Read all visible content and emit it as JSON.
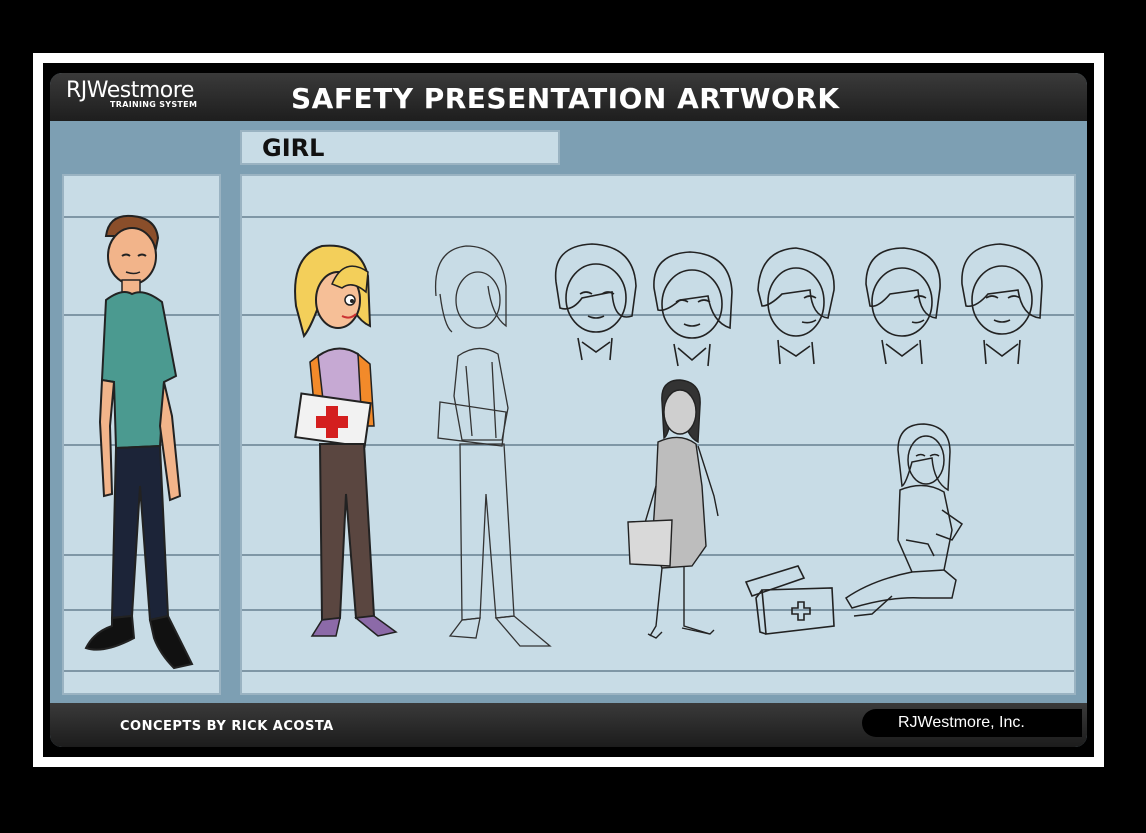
{
  "header": {
    "logo_main": "RJWestmore",
    "logo_sub": "TRAINING SYSTEM",
    "title": "SAFETY PRESENTATION ARTWORK"
  },
  "section_label": "GIRL",
  "footer": {
    "credit": "CONCEPTS BY RICK ACOSTA",
    "company": "RJWestmore, Inc."
  },
  "colors": {
    "background": "#000000",
    "frame": "#ffffff",
    "panel": "#7d9fb3",
    "board": "#c8dce6",
    "header": "#2a2a2a"
  },
  "illustrations": [
    "man-character-color",
    "girl-character-color",
    "girl-character-sketch",
    "girl-head-sketches",
    "girl-walking-sketch",
    "first-aid-kit-sketch",
    "girl-kneeling-sketch"
  ]
}
